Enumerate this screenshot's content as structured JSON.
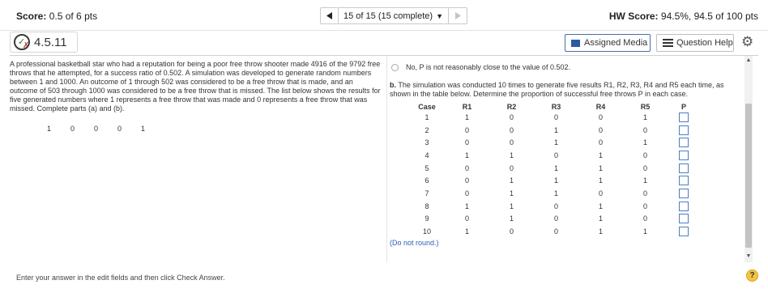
{
  "topbar": {
    "score_label": "Score:",
    "score_value": "0.5 of 6 pts",
    "nav_position": "15 of 15 (15 complete)",
    "hw_label": "HW Score:",
    "hw_value": "94.5%, 94.5 of 100 pts"
  },
  "question": {
    "number": "4.5.11",
    "assigned_media_label": "Assigned Media",
    "question_help_label": "Question Help"
  },
  "problem": {
    "text": "A professional basketball star who had a reputation for being a poor free throw shooter made 4916 of the 9792 free throws that he attempted, for a success ratio of 0.502. A simulation was developed to generate random numbers between 1 and 1000. An outcome of 1 through 502 was considered to be a free throw that is made, and an outcome of 503 through 1000 was considered to be a free throw that is missed. The list below shows the results for five generated numbers where 1 represents a free throw that was made and 0 represents a free throw that was missed. Complete parts (a) and (b).",
    "sequence": [
      "1",
      "0",
      "0",
      "0",
      "1"
    ]
  },
  "part_a": {
    "option_text": "No, P is not reasonably close to the value of 0.502."
  },
  "part_b": {
    "label": "b.",
    "text": "The simulation was conducted 10 times to generate five results R1, R2, R3, R4 and R5 each time, as shown in the table below. Determine the proportion of successful free throws P in each case.",
    "headers": [
      "Case",
      "R1",
      "R2",
      "R3",
      "R4",
      "R5",
      "P"
    ],
    "rows": [
      [
        "1",
        "1",
        "0",
        "0",
        "0",
        "1"
      ],
      [
        "2",
        "0",
        "0",
        "1",
        "0",
        "0"
      ],
      [
        "3",
        "0",
        "0",
        "1",
        "0",
        "1"
      ],
      [
        "4",
        "1",
        "1",
        "0",
        "1",
        "0"
      ],
      [
        "5",
        "0",
        "0",
        "1",
        "1",
        "0"
      ],
      [
        "6",
        "0",
        "1",
        "1",
        "1",
        "1"
      ],
      [
        "7",
        "0",
        "1",
        "1",
        "0",
        "0"
      ],
      [
        "8",
        "1",
        "1",
        "0",
        "1",
        "0"
      ],
      [
        "9",
        "0",
        "1",
        "0",
        "1",
        "0"
      ],
      [
        "10",
        "1",
        "0",
        "0",
        "1",
        "1"
      ]
    ],
    "note": "(Do not round.)"
  },
  "footer": {
    "instruction": "Enter your answer in the edit fields and then click Check Answer.",
    "help_symbol": "?"
  },
  "colors": {
    "accent_blue": "#4a7fc1",
    "media_blue": "#2c5aa0",
    "help_yellow": "#f5c242"
  }
}
